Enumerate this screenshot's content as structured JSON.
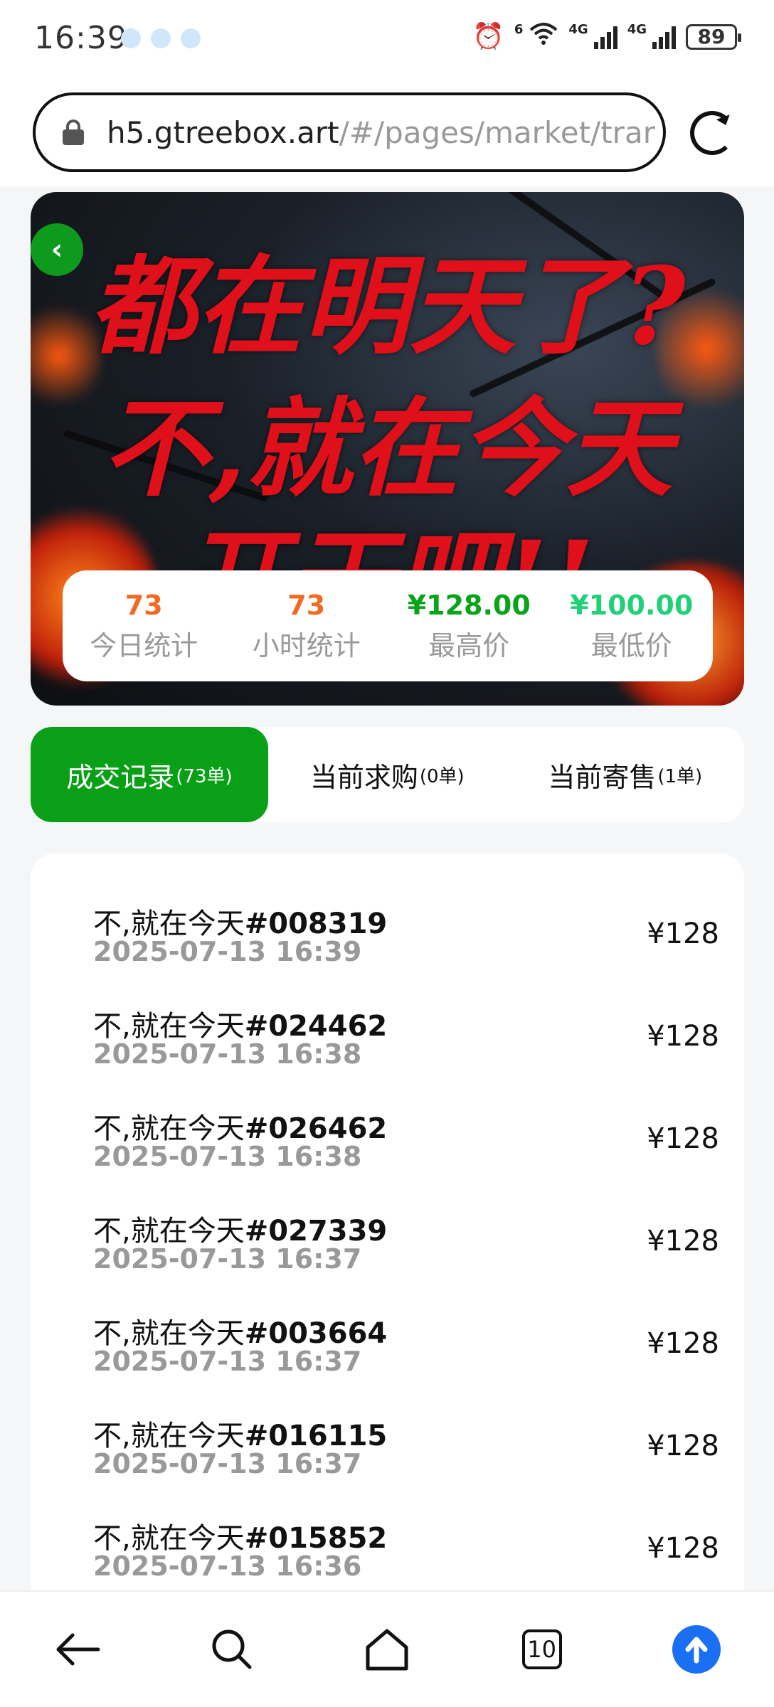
{
  "status_bar": {
    "time": "16:39",
    "network_1": "4G",
    "network_2": "4G",
    "wifi_label": "6",
    "battery": "89",
    "icons": [
      "alarm-icon",
      "wifi-icon",
      "signal-icon",
      "signal-icon",
      "battery-icon"
    ]
  },
  "browser": {
    "url_host": "h5.gtreebox.art",
    "url_path": "/#/pages/market/trar",
    "reload_icon": "reload-icon"
  },
  "banner": {
    "line1": "都在明天了?",
    "line2": "不,就在今天",
    "line3": "开干吧!!"
  },
  "stats": [
    {
      "value": "73",
      "label": "今日统计",
      "color": "#f26a22"
    },
    {
      "value": "73",
      "label": "小时统计",
      "color": "#f26a22"
    },
    {
      "value": "¥128.00",
      "label": "最高价",
      "color": "#0aa41a"
    },
    {
      "value": "¥100.00",
      "label": "最低价",
      "color": "#22d07a"
    }
  ],
  "tabs": [
    {
      "label": "成交记录",
      "count": "(73单)"
    },
    {
      "label": "当前求购",
      "count": "(0单)"
    },
    {
      "label": "当前寄售",
      "count": "(1单)"
    }
  ],
  "records": [
    {
      "name": "不,就在今天",
      "id": "#008319",
      "time": "2025-07-13 16:39",
      "price": "¥128"
    },
    {
      "name": "不,就在今天",
      "id": "#024462",
      "time": "2025-07-13 16:38",
      "price": "¥128"
    },
    {
      "name": "不,就在今天",
      "id": "#026462",
      "time": "2025-07-13 16:38",
      "price": "¥128"
    },
    {
      "name": "不,就在今天",
      "id": "#027339",
      "time": "2025-07-13 16:37",
      "price": "¥128"
    },
    {
      "name": "不,就在今天",
      "id": "#003664",
      "time": "2025-07-13 16:37",
      "price": "¥128"
    },
    {
      "name": "不,就在今天",
      "id": "#016115",
      "time": "2025-07-13 16:37",
      "price": "¥128"
    },
    {
      "name": "不,就在今天",
      "id": "#015852",
      "time": "2025-07-13 16:36",
      "price": "¥128"
    }
  ],
  "nav": {
    "tab_count": "10",
    "icons": [
      "back-arrow-icon",
      "search-icon",
      "home-icon",
      "tabs-icon",
      "upload-icon"
    ]
  },
  "colors": {
    "accent": "#09a017",
    "upload": "#1a6ff2"
  }
}
